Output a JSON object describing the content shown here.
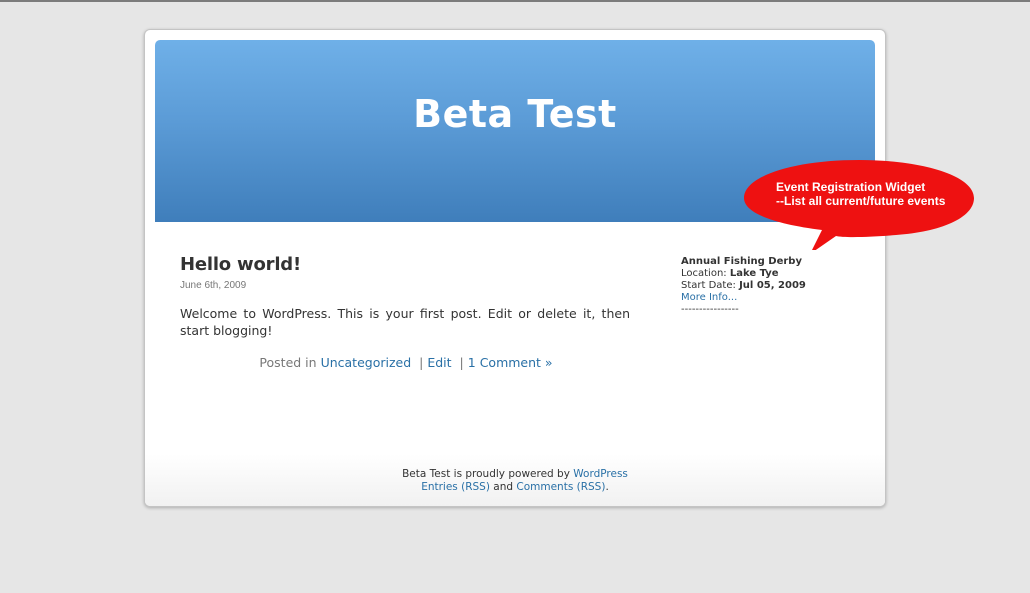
{
  "site": {
    "title": "Beta Test"
  },
  "post": {
    "title": "Hello world!",
    "date": "June 6th, 2009",
    "content": "Welcome to WordPress. This is your first post. Edit or delete it, then start blogging!",
    "meta": {
      "posted_in_label": "Posted in",
      "category": "Uncategorized",
      "edit": "Edit",
      "separator": "|",
      "comments": "1 Comment »"
    }
  },
  "sidebar": {
    "event": {
      "name": "Annual Fishing Derby",
      "location_label": "Location:",
      "location": "Lake Tye",
      "start_label": "Start Date:",
      "start_date": "Jul 05, 2009",
      "more_info": "More Info...",
      "divider": "----------------"
    }
  },
  "callout": {
    "line1": "Event Registration Widget",
    "line2": "--List all current/future events",
    "color": "#ee1111"
  },
  "footer": {
    "powered_text": "Beta Test is proudly powered by",
    "wordpress": "WordPress",
    "entries_rss": "Entries (RSS)",
    "and": "and",
    "comments_rss": "Comments (RSS)",
    "period": "."
  },
  "colors": {
    "background": "#e6e6e6",
    "header_top": "#6fb0e8",
    "header_bottom": "#3f7ebb",
    "link": "#2970a6"
  }
}
